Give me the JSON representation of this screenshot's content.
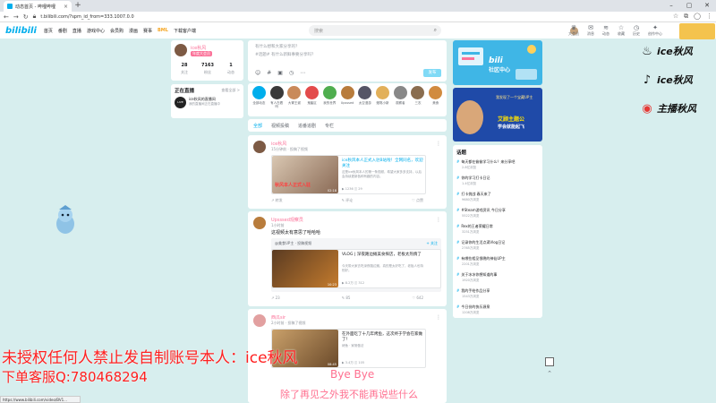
{
  "browser": {
    "tab_title": "动态首页 - 哔哩哔哩",
    "tab_close": "×",
    "new_tab": "+",
    "win_min": "–",
    "win_max": "▢",
    "win_close": "✕",
    "url": "t.bilibili.com/?spm_id_from=333.1007.0.0",
    "status_url": "https://www.bilibili.com/video/BV1..."
  },
  "header": {
    "logo": "bilibili",
    "nav": [
      "首页",
      "番剧",
      "直播",
      "游戏中心",
      "会员购",
      "漫画",
      "赛事",
      "BML",
      "下载客户端"
    ],
    "search_placeholder": "搜索",
    "right_icons": [
      {
        "label": "大会员",
        "icon": "crown-icon"
      },
      {
        "label": "消息",
        "icon": "mail-icon"
      },
      {
        "label": "动态",
        "icon": "wind-icon"
      },
      {
        "label": "收藏",
        "icon": "star-icon"
      },
      {
        "label": "历史",
        "icon": "clock-icon"
      },
      {
        "label": "创作中心",
        "icon": "bulb-icon"
      }
    ]
  },
  "profile": {
    "name": "ice秋风",
    "vip": "年度大会员",
    "stats": [
      {
        "value": "28",
        "label": "关注"
      },
      {
        "value": "7163",
        "label": "粉丝"
      },
      {
        "value": "1",
        "label": "动态"
      }
    ]
  },
  "live": {
    "title": "正在直播",
    "more": "查看全部 >",
    "streamer": "ice秋风的直播间",
    "status": "我的直播间正在直播中"
  },
  "composer": {
    "title": "有什么想和大家分享的？",
    "placeholder": "#话题# 有什么新鲜事要分享吗？",
    "send": "发布",
    "icons": [
      "☺",
      "#",
      "▣",
      "◷",
      "⋯"
    ]
  },
  "ups": [
    {
      "label": "全部动态",
      "color": "#00aeec"
    },
    {
      "label": "有人在看吗",
      "color": "#3a3a3a"
    },
    {
      "label": "大胃王谢",
      "color": "#c98a5a"
    },
    {
      "label": "鬼畜区",
      "color": "#e34b4b"
    },
    {
      "label": "我的世界",
      "color": "#4fae4f"
    },
    {
      "label": "Upsssed",
      "color": "#b87c3c"
    },
    {
      "label": "太空漫游",
      "color": "#556"
    },
    {
      "label": "蜡笔小新",
      "color": "#e2b05a"
    },
    {
      "label": "观察者",
      "color": "#888"
    },
    {
      "label": "三农",
      "color": "#8a6d4f"
    },
    {
      "label": "美食",
      "color": "#d18b3f"
    }
  ],
  "feed_tabs": [
    "全部",
    "视频投稿",
    "追番追剧",
    "专栏"
  ],
  "posts": [
    {
      "name": "ice秋风",
      "time": "15分钟前 · 投稿了视频",
      "text": "",
      "video_title": "ice秋风本人正式入驻B站啦！全网同名，欢迎关注",
      "video_desc": "这是ice秋风本人的第一条视频，希望大家多多支持，以后会持续更新各种有趣的内容。",
      "thumb_caption": "秋风本人正式入驻",
      "duration": "02:18",
      "video_stats": "▶ 1236   ◫ 29",
      "actions": [
        "↗ 转发",
        "✎ 评论",
        "♡ 点赞"
      ]
    },
    {
      "name": "Upsssed观察员",
      "time": "1小时前",
      "text": "这视频太有意思了哈哈哈",
      "fwd_name": "@美食UP主 · 投稿视频",
      "fwd_more": "+ 关注",
      "video_title": "VLOG | 深夜路边摊美食探店，老板太热情了",
      "video_desc": "今天带大家去吃深夜路边摊，真的是太好吃了，老板人也特别好。",
      "thumb_caption": "",
      "duration": "10:23",
      "video_stats": "▶ 8.2万   ◫ 312",
      "actions": [
        "↗ 23",
        "✎ 85",
        "♡ 642"
      ]
    },
    {
      "name": "西瓜sir",
      "time": "2小时前 · 投稿了视频",
      "text": "",
      "video_title": "在外面吃了十几年烤鱼，这次终于学会在家做了！",
      "video_desc": "烤鱼 · 家常做法",
      "thumb_caption": "",
      "duration": "08:45",
      "video_stats": "▶ 3.4万   ◫ 105",
      "actions": []
    }
  ],
  "right": {
    "banner1_logo": "bili",
    "banner1_text": "社区中心",
    "banner2_top": "我发现了一个宝藏UP主",
    "banner2_title": "艾顾主题公",
    "banner2_sub": "学会就能起飞",
    "topics_title": "话题",
    "topics": [
      {
        "title": "每天都在偷偷学习什么？来分享吧",
        "views": "2.8亿浏览"
      },
      {
        "title": "你的学习打卡日记",
        "views": "1.4亿浏览"
      },
      {
        "title": "打卡挑战 春天来了",
        "views": "9680万浏览"
      },
      {
        "title": "#Steam游戏资讯 今日分享",
        "views": "5522万浏览"
      },
      {
        "title": "Rex的王者荣耀日常",
        "views": "3251万浏览"
      },
      {
        "title": "记录你的生活点滴Vlog日记",
        "views": "2765万浏览"
      },
      {
        "title": "有哪些相见恨晚的神仙UP主",
        "views": "2201万浏览"
      },
      {
        "title": "关于冰冰你想知道的事",
        "views": "1920万浏览"
      },
      {
        "title": "我的手绘作品分享",
        "views": "1543万浏览"
      },
      {
        "title": "今日份的快乐源泉",
        "views": "1208万浏览"
      }
    ]
  },
  "social": [
    {
      "name": "ice秋风",
      "icon": "♨"
    },
    {
      "name": "ice秋风",
      "icon": "♪"
    },
    {
      "name": "主播秋风",
      "icon": "◉"
    }
  ],
  "watermark": {
    "line1": "未授权任何人禁止发自制账号本人：ice秋风",
    "line2": "下单客服Q:780468294"
  },
  "subtitles": {
    "line1": "Bye Bye",
    "line2": "除了再见之外我不能再说些什么"
  }
}
